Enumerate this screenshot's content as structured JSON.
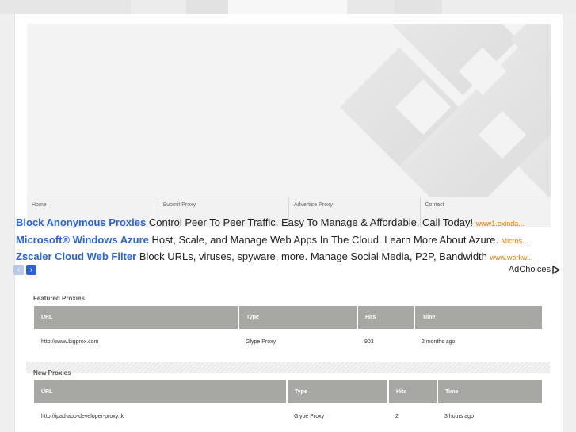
{
  "colors": {
    "ad_title": "#2a63d9",
    "ad_url": "#e07b00",
    "table_header": "#a7a7a4",
    "adnav_prev": "#b9c9ea",
    "adnav_next": "#2a63d9"
  },
  "nav": {
    "items": [
      "Home",
      "Submit Proxy",
      "Advertise Proxy",
      "Contact"
    ]
  },
  "ads": [
    {
      "title": "Block Anonymous Proxies",
      "text": "Control Peer To Peer Traffic. Easy To Manage & Affordable. Call Today!",
      "url": "www1.exinda..."
    },
    {
      "title": "Microsoft® Windows Azure",
      "text": "Host, Scale, and Manage Web Apps In The Cloud. Learn More About Azure.",
      "url": "Micros..."
    },
    {
      "title": "Zscaler Cloud Web Filter",
      "text": "Block URLs, viruses, spyware, more. Manage Social Media, P2P, Bandwidth",
      "url": "www.workw..."
    }
  ],
  "ad_nav": {
    "prev_icon": "chevron-left-icon",
    "next_icon": "chevron-right-icon"
  },
  "adchoices": {
    "label": "AdChoices",
    "icon": "adchoices-triangle-icon"
  },
  "featured": {
    "title": "Featured Proxies",
    "columns": [
      "URL",
      "Type",
      "Hits",
      "Time"
    ],
    "rows": [
      {
        "url": "http://www.bigprox.com",
        "type": "Glype Proxy",
        "hits": "903",
        "time": "2 months ago"
      }
    ]
  },
  "new_proxies": {
    "title": "New Proxies",
    "columns": [
      "URL",
      "Type",
      "Hits",
      "Time"
    ],
    "rows": [
      {
        "url": "http://ipad-app-developer-proxy.tk",
        "type": "Glype Proxy",
        "hits": "2",
        "time": "3 hours ago"
      }
    ]
  }
}
